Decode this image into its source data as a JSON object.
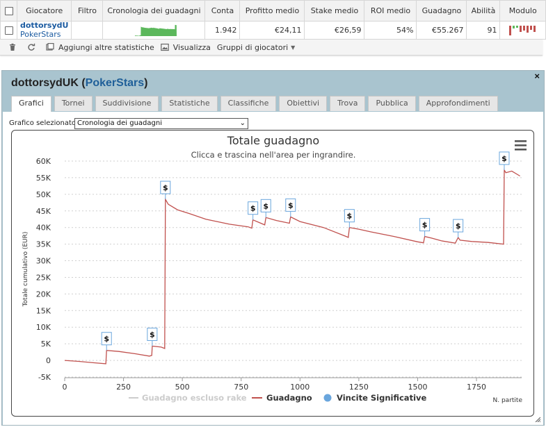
{
  "table": {
    "headers": [
      "Giocatore",
      "Filtro",
      "Cronologia dei guadagni",
      "Conta",
      "Profitto medio",
      "Stake medio",
      "ROI medio",
      "Guadagno",
      "Abilità",
      "Modulo"
    ],
    "row": {
      "player": "dottorsydU",
      "site": "PokerStars",
      "filtro": "",
      "conta": "1.942",
      "profitto_medio": "€24,11",
      "stake_medio": "€26,59",
      "roi_medio": "54%",
      "guadagno": "€55.267",
      "abilita": "91"
    }
  },
  "toolbar": {
    "add_stats": "Aggiungi altre statistiche",
    "view": "Visualizza",
    "groups": "Gruppi di giocatori"
  },
  "panel": {
    "player": "dottorsydUK",
    "site": "PokerStars",
    "close": "×",
    "tabs": [
      "Grafici",
      "Tornei",
      "Suddivisione",
      "Statistiche",
      "Classifiche",
      "Obiettivi",
      "Trova",
      "Pubblica",
      "Approfondimenti"
    ],
    "active_tab": "Grafici",
    "select_label": "Grafico selezionato",
    "select_value": "Cronologia dei guadagni"
  },
  "colors": {
    "line": "#c0504d",
    "rake_line": "#cccccc",
    "marker": "#6aa6dd",
    "sparkline": "#5cb85c",
    "panel_bg": "#a9c4cf",
    "player_link": "#1a5aa0"
  },
  "chart_data": {
    "type": "line",
    "title": "Totale guadagno",
    "subtitle": "Clicca e trascina nell'area per ingrandire.",
    "xlabel": "N. partite",
    "ylabel": "Totale cumulativo (EUR)",
    "xlim": [
      0,
      1942
    ],
    "ylim": [
      -5000,
      60000
    ],
    "xticks": [
      0,
      250,
      500,
      750,
      1000,
      1250,
      1500,
      1750
    ],
    "yticks": [
      -5000,
      0,
      5000,
      10000,
      15000,
      20000,
      25000,
      30000,
      35000,
      40000,
      45000,
      50000,
      55000,
      60000
    ],
    "ytick_labels": [
      "-5K",
      "0",
      "5K",
      "10K",
      "15K",
      "20K",
      "25K",
      "30K",
      "35K",
      "40K",
      "45K",
      "50K",
      "55K",
      "60K"
    ],
    "grid": true,
    "legend": "bottom",
    "legend_entries": [
      "Guadagno escluso rake",
      "Guadagno",
      "Vincite Significative"
    ],
    "series": [
      {
        "name": "Guadagno",
        "x": [
          0,
          60,
          120,
          175,
          178,
          230,
          300,
          360,
          370,
          372,
          410,
          425,
          428,
          440,
          480,
          530,
          600,
          700,
          780,
          795,
          800,
          850,
          855,
          900,
          955,
          960,
          1000,
          1100,
          1200,
          1205,
          1210,
          1250,
          1300,
          1400,
          1500,
          1525,
          1530,
          1560,
          1600,
          1660,
          1672,
          1680,
          1730,
          1800,
          1865,
          1868,
          1875,
          1900,
          1935
        ],
        "y": [
          0,
          -300,
          -700,
          -1000,
          3000,
          2700,
          2000,
          1300,
          1500,
          4300,
          4000,
          3600,
          48500,
          47000,
          45300,
          44200,
          42500,
          41000,
          40200,
          39800,
          42300,
          40800,
          43000,
          42100,
          41300,
          43200,
          41800,
          40000,
          37200,
          37000,
          40000,
          39500,
          38700,
          37300,
          35700,
          35400,
          37300,
          36800,
          36000,
          35300,
          37000,
          36200,
          35800,
          35500,
          35000,
          57300,
          56500,
          57000,
          55500
        ]
      },
      {
        "name": "Vincite Significative",
        "x": [
          178,
          372,
          428,
          800,
          855,
          960,
          1210,
          1530,
          1672,
          1868
        ],
        "y": [
          3000,
          4300,
          48500,
          42300,
          43000,
          43200,
          40000,
          37300,
          37000,
          57300
        ]
      }
    ],
    "marker_label": "$"
  }
}
